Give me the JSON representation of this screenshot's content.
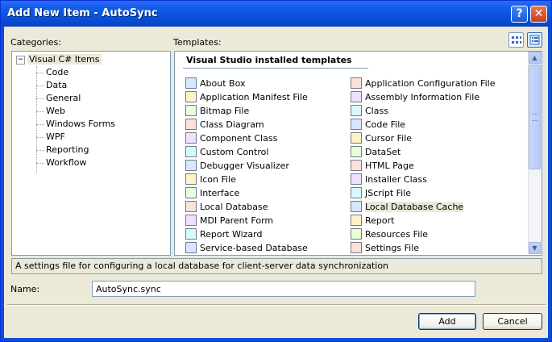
{
  "window": {
    "title": "Add New Item - AutoSync",
    "help_glyph": "?",
    "close_glyph": "✕"
  },
  "categories": {
    "label": "Categories:",
    "root": "Visual C# Items",
    "expander": "−",
    "items": [
      "Code",
      "Data",
      "General",
      "Web",
      "Windows Forms",
      "WPF",
      "Reporting",
      "Workflow"
    ]
  },
  "templates": {
    "label": "Templates:",
    "header": "Visual Studio installed templates",
    "left": [
      {
        "label": "About Box",
        "icon": "form-icon"
      },
      {
        "label": "Application Manifest File",
        "icon": "manifest-icon"
      },
      {
        "label": "Bitmap File",
        "icon": "bitmap-icon"
      },
      {
        "label": "Class Diagram",
        "icon": "diagram-icon"
      },
      {
        "label": "Component Class",
        "icon": "component-icon"
      },
      {
        "label": "Custom Control",
        "icon": "control-icon"
      },
      {
        "label": "Debugger Visualizer",
        "icon": "visualizer-icon"
      },
      {
        "label": "Icon File",
        "icon": "icon-file-icon"
      },
      {
        "label": "Interface",
        "icon": "interface-icon"
      },
      {
        "label": "Local Database",
        "icon": "database-icon"
      },
      {
        "label": "MDI Parent Form",
        "icon": "mdi-form-icon"
      },
      {
        "label": "Report Wizard",
        "icon": "wizard-icon"
      },
      {
        "label": "Service-based Database",
        "icon": "database-icon"
      }
    ],
    "right": [
      {
        "label": "Application Configuration File",
        "icon": "config-icon"
      },
      {
        "label": "Assembly Information File",
        "icon": "assembly-icon"
      },
      {
        "label": "Class",
        "icon": "class-icon"
      },
      {
        "label": "Code File",
        "icon": "code-file-icon"
      },
      {
        "label": "Cursor File",
        "icon": "cursor-icon"
      },
      {
        "label": "DataSet",
        "icon": "dataset-icon"
      },
      {
        "label": "HTML Page",
        "icon": "html-icon"
      },
      {
        "label": "Installer Class",
        "icon": "installer-icon"
      },
      {
        "label": "JScript File",
        "icon": "jscript-icon"
      },
      {
        "label": "Local Database Cache",
        "icon": "database-cache-icon",
        "selected": true
      },
      {
        "label": "Report",
        "icon": "report-icon"
      },
      {
        "label": "Resources File",
        "icon": "resources-icon"
      },
      {
        "label": "Settings File",
        "icon": "settings-icon"
      }
    ]
  },
  "description": "A settings file for configuring a local database for client-server data synchronization",
  "name_field": {
    "label": "Name:",
    "value": "AutoSync.sync"
  },
  "buttons": {
    "add": "Add",
    "cancel": "Cancel"
  },
  "colors": {
    "title_bar": "#0a4fd6",
    "dialog_bg": "#ece9d8",
    "border": "#7f9db9"
  }
}
